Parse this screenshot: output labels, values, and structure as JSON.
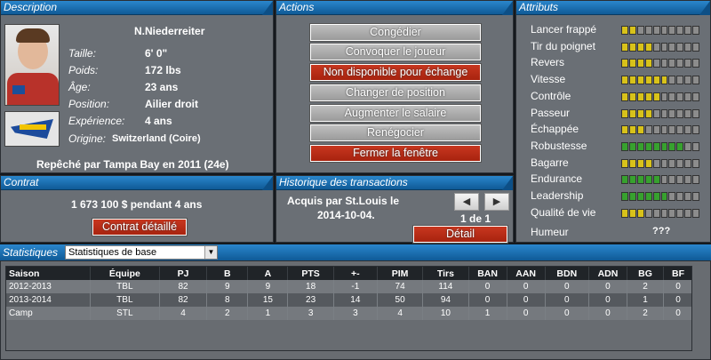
{
  "description": {
    "title": "Description",
    "name": "N.Niederreiter",
    "fields": [
      {
        "label": "Taille:",
        "value": "6' 0\""
      },
      {
        "label": "Poids:",
        "value": "172 lbs"
      },
      {
        "label": "Âge:",
        "value": "23 ans"
      },
      {
        "label": "Position:",
        "value": "Ailier droit"
      },
      {
        "label": "Expérience:",
        "value": "4 ans"
      },
      {
        "label": "Origine:",
        "value": "Switzerland (Coire)"
      }
    ],
    "draft": "Repêché par Tampa Bay en 2011 (24e)"
  },
  "actions": {
    "title": "Actions",
    "buttons": [
      "Congédier",
      "Convoquer le joueur",
      "Non disponible pour échange",
      "Changer de position",
      "Augmenter le salaire",
      "Renégocier",
      "Fermer la fenêtre"
    ]
  },
  "attributes": {
    "title": "Attributs",
    "items": [
      {
        "name": "Lancer frappé",
        "level": 2,
        "color": "y"
      },
      {
        "name": "Tir du poignet",
        "level": 4,
        "color": "y"
      },
      {
        "name": "Revers",
        "level": 4,
        "color": "y"
      },
      {
        "name": "Vitesse",
        "level": 6,
        "color": "y"
      },
      {
        "name": "Contrôle",
        "level": 5,
        "color": "y"
      },
      {
        "name": "Passeur",
        "level": 4,
        "color": "y"
      },
      {
        "name": "Échappée",
        "level": 3,
        "color": "y"
      },
      {
        "name": "Robustesse",
        "level": 8,
        "color": "g"
      },
      {
        "name": "Bagarre",
        "level": 4,
        "color": "y"
      },
      {
        "name": "Endurance",
        "level": 5,
        "color": "g"
      },
      {
        "name": "Leadership",
        "level": 6,
        "color": "g"
      },
      {
        "name": "Qualité de vie",
        "level": 3,
        "color": "y"
      }
    ],
    "humeur_label": "Humeur",
    "humeur_value": "???"
  },
  "contract": {
    "title": "Contrat",
    "text": "1 673 100 $ pendant 4 ans",
    "button": "Contrat détaillé"
  },
  "history": {
    "title": "Historique des transactions",
    "text1": "Acquis par St.Louis le",
    "text2": "2014-10-04.",
    "prev": "◀",
    "next": "▶",
    "pager": "1 de 1",
    "button": "Détail"
  },
  "stats": {
    "title": "Statistiques",
    "select": "Statistiques de base",
    "headers": [
      "Saison",
      "Équipe",
      "PJ",
      "B",
      "A",
      "PTS",
      "+-",
      "PIM",
      "Tirs",
      "BAN",
      "AAN",
      "BDN",
      "ADN",
      "BG",
      "BF"
    ],
    "rows": [
      [
        "2012-2013",
        "TBL",
        "82",
        "9",
        "9",
        "18",
        "-1",
        "74",
        "114",
        "0",
        "0",
        "0",
        "0",
        "2",
        "0"
      ],
      [
        "2013-2014",
        "TBL",
        "82",
        "8",
        "15",
        "23",
        "14",
        "50",
        "94",
        "0",
        "0",
        "0",
        "0",
        "1",
        "0"
      ],
      [
        "Camp",
        "STL",
        "4",
        "2",
        "1",
        "3",
        "3",
        "4",
        "10",
        "1",
        "0",
        "0",
        "0",
        "2",
        "0"
      ]
    ]
  }
}
